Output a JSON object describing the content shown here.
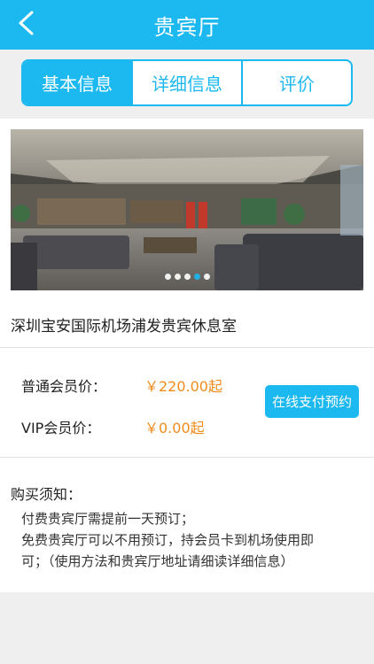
{
  "header": {
    "title": "贵宾厅"
  },
  "tabs": [
    {
      "label": "基本信息"
    },
    {
      "label": "详细信息"
    },
    {
      "label": "评价"
    }
  ],
  "lounge": {
    "name": "深圳宝安国际机场浦发贵宾休息室",
    "carousel_total": 5,
    "carousel_active_index": 3
  },
  "prices": {
    "regular_label": "普通会员价：",
    "regular_value": "￥220.00起",
    "vip_label": "VIP会员价：",
    "vip_value": "￥0.00起",
    "pay_button": "在线支付预约"
  },
  "notice": {
    "title": "购买须知：",
    "lines": [
      "付费贵宾厅需提前一天预订；",
      "免费贵宾厅可以不用预订，持会员卡到机场使用即",
      "可；（使用方法和贵宾厅地址请细读详细信息）"
    ]
  },
  "colors": {
    "accent": "#1cb8f0",
    "price": "#f08c1e"
  },
  "icons": {
    "back": "chevron-left-icon"
  }
}
